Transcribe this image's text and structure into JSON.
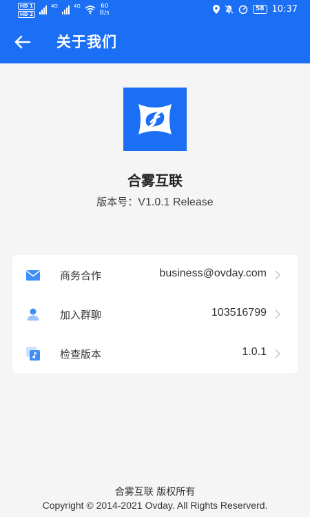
{
  "status_bar": {
    "hd1": "HD 1",
    "hd2": "HD 2",
    "net1": "4G",
    "net2": "4G",
    "speed_value": "60",
    "speed_unit": "B/s",
    "battery": "58",
    "time": "10:37"
  },
  "nav": {
    "title": "关于我们"
  },
  "app": {
    "name": "合雾互联",
    "version_label": "版本号：",
    "version": "V1.0.1 Release"
  },
  "info_rows": [
    {
      "label": "商务合作",
      "value": "business@ovday.com",
      "icon": "mail-icon"
    },
    {
      "label": "加入群聊",
      "value": "103516799",
      "icon": "group-chat-icon"
    },
    {
      "label": "检查版本",
      "value": "1.0.1",
      "icon": "update-icon"
    }
  ],
  "footer": {
    "line1": "合雾互联 版权所有",
    "line2": "Copyright © 2014-2021 Ovday. All Rights Reserverd."
  },
  "colors": {
    "primary": "#1a6ff5",
    "background": "#f5f5f5",
    "card": "#ffffff",
    "icon_blue": "#3d8ef7"
  }
}
